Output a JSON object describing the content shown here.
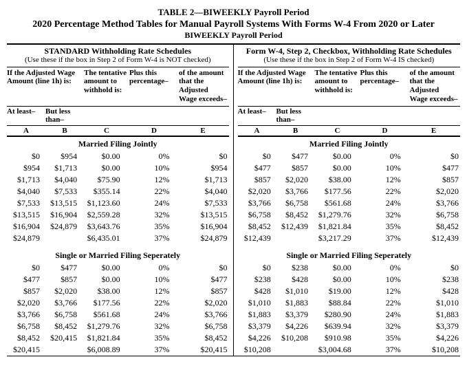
{
  "title1": "TABLE 2—BIWEEKLY Payroll Period",
  "title2": "2020 Percentage Method Tables for Manual Payroll Systems With Forms W-4 From 2020 or Later",
  "title3": "BIWEEKLY Payroll Period",
  "leftSchedule": {
    "heading1": "STANDARD Withholding Rate Schedules",
    "heading2": "(Use these if the box in Step 2 of Form W-4 is NOT checked)"
  },
  "rightSchedule": {
    "heading1": "Form W-4, Step 2, Checkbox, Withholding Rate Schedules",
    "heading2": "(Use these if the box in Step 2 of Form W-4 IS checked)"
  },
  "colTitles": {
    "ab": "If the Adjusted Wage Amount (line 1h) is:",
    "c": "The tentative amount to withhold is:",
    "d": "Plus this percentage–",
    "e": "of the amount that the Adjusted Wage exceeds–",
    "subA": "At least–",
    "subB": "But less than–",
    "A": "A",
    "B": "B",
    "C": "C",
    "D": "D",
    "E": "E"
  },
  "sections": {
    "mfj": "Married Filing Jointly",
    "single": "Single or Married Filing Seperately"
  },
  "chart_data": [
    {
      "type": "table",
      "title": "STANDARD Withholding — Married Filing Jointly",
      "columns": [
        "At least",
        "But less than",
        "Tentative amount",
        "Plus percentage",
        "Wage exceeds"
      ],
      "rows": [
        [
          "$0",
          "$954",
          "$0.00",
          "0%",
          "$0"
        ],
        [
          "$954",
          "$1,713",
          "$0.00",
          "10%",
          "$954"
        ],
        [
          "$1,713",
          "$4,040",
          "$75.90",
          "12%",
          "$1,713"
        ],
        [
          "$4,040",
          "$7,533",
          "$355.14",
          "22%",
          "$4,040"
        ],
        [
          "$7,533",
          "$13,515",
          "$1,123.60",
          "24%",
          "$7,533"
        ],
        [
          "$13,515",
          "$16,904",
          "$2,559.28",
          "32%",
          "$13,515"
        ],
        [
          "$16,904",
          "$24,879",
          "$3,643.76",
          "35%",
          "$16,904"
        ],
        [
          "$24,879",
          "",
          "$6,435.01",
          "37%",
          "$24,879"
        ]
      ]
    },
    {
      "type": "table",
      "title": "Checkbox Withholding — Married Filing Jointly",
      "columns": [
        "At least",
        "But less than",
        "Tentative amount",
        "Plus percentage",
        "Wage exceeds"
      ],
      "rows": [
        [
          "$0",
          "$477",
          "$0.00",
          "0%",
          "$0"
        ],
        [
          "$477",
          "$857",
          "$0.00",
          "10%",
          "$477"
        ],
        [
          "$857",
          "$2,020",
          "$38.00",
          "12%",
          "$857"
        ],
        [
          "$2,020",
          "$3,766",
          "$177.56",
          "22%",
          "$2,020"
        ],
        [
          "$3,766",
          "$6,758",
          "$561.68",
          "24%",
          "$3,766"
        ],
        [
          "$6,758",
          "$8,452",
          "$1,279.76",
          "32%",
          "$6,758"
        ],
        [
          "$8,452",
          "$12,439",
          "$1,821.84",
          "35%",
          "$8,452"
        ],
        [
          "$12,439",
          "",
          "$3,217.29",
          "37%",
          "$12,439"
        ]
      ]
    },
    {
      "type": "table",
      "title": "STANDARD Withholding — Single or Married Filing Separately",
      "columns": [
        "At least",
        "But less than",
        "Tentative amount",
        "Plus percentage",
        "Wage exceeds"
      ],
      "rows": [
        [
          "$0",
          "$477",
          "$0.00",
          "0%",
          "$0"
        ],
        [
          "$477",
          "$857",
          "$0.00",
          "10%",
          "$477"
        ],
        [
          "$857",
          "$2,020",
          "$38.00",
          "12%",
          "$857"
        ],
        [
          "$2,020",
          "$3,766",
          "$177.56",
          "22%",
          "$2,020"
        ],
        [
          "$3,766",
          "$6,758",
          "$561.68",
          "24%",
          "$3,766"
        ],
        [
          "$6,758",
          "$8,452",
          "$1,279.76",
          "32%",
          "$6,758"
        ],
        [
          "$8,452",
          "$20,415",
          "$1,821.84",
          "35%",
          "$8,452"
        ],
        [
          "$20,415",
          "",
          "$6,008.89",
          "37%",
          "$20,415"
        ]
      ]
    },
    {
      "type": "table",
      "title": "Checkbox Withholding — Single or Married Filing Separately",
      "columns": [
        "At least",
        "But less than",
        "Tentative amount",
        "Plus percentage",
        "Wage exceeds"
      ],
      "rows": [
        [
          "$0",
          "$238",
          "$0.00",
          "0%",
          "$0"
        ],
        [
          "$238",
          "$428",
          "$0.00",
          "10%",
          "$238"
        ],
        [
          "$428",
          "$1,010",
          "$19.00",
          "12%",
          "$428"
        ],
        [
          "$1,010",
          "$1,883",
          "$88.84",
          "22%",
          "$1,010"
        ],
        [
          "$1,883",
          "$3,379",
          "$280.90",
          "24%",
          "$1,883"
        ],
        [
          "$3,379",
          "$4,226",
          "$639.94",
          "32%",
          "$3,379"
        ],
        [
          "$4,226",
          "$10,208",
          "$910.98",
          "35%",
          "$4,226"
        ],
        [
          "$10,208",
          "",
          "$3,004.68",
          "37%",
          "$10,208"
        ]
      ]
    }
  ]
}
